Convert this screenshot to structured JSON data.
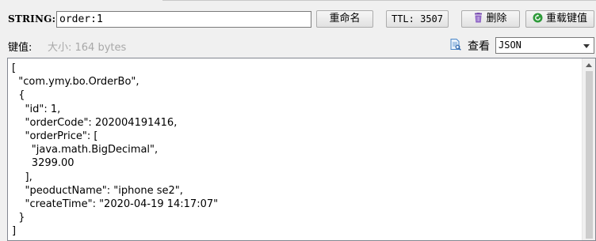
{
  "key_row": {
    "type_label": "STRING:",
    "key_value": "order:1",
    "rename_button": "重命名",
    "ttl_label": "TTL: 3507",
    "delete_button": "删除",
    "reload_button": "重载键值"
  },
  "value_row": {
    "value_label": "键值:",
    "size_label": "大小: 164 bytes",
    "view_label": "查看",
    "view_format": "JSON"
  },
  "editor": {
    "content": "[\n  \"com.ymy.bo.OrderBo\",\n  {\n    \"id\": 1,\n    \"orderCode\": 202004191416,\n    \"orderPrice\": [\n      \"java.math.BigDecimal\",\n      3299.00\n    ],\n    \"peoductName\": \"iphone se2\",\n    \"createTime\": \"2020-04-19 14:17:07\"\n  }\n]"
  },
  "icons": {
    "delete": "trash-icon",
    "reload": "reload-icon",
    "view": "document-view-icon",
    "dropdown": "chevron-down-icon"
  },
  "colors": {
    "delete_icon": "#7a4fb0",
    "reload_icon": "#2e9a3a",
    "size_text": "#a8a8a8"
  }
}
